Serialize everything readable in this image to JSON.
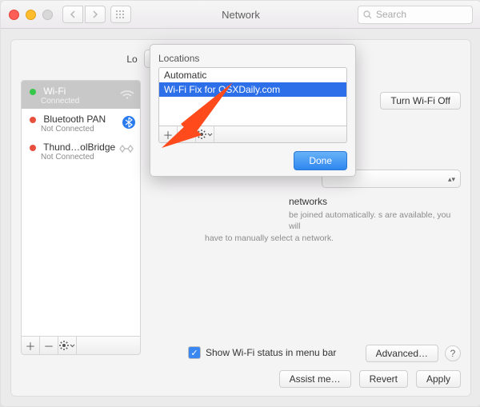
{
  "window": {
    "title": "Network"
  },
  "search": {
    "placeholder": "Search"
  },
  "location_label": "Lo",
  "services": [
    {
      "name": "Wi-Fi",
      "status": "Connected",
      "dot": "#37c84a",
      "selected": true,
      "icon": "wifi"
    },
    {
      "name": "Bluetooth PAN",
      "status": "Not Connected",
      "dot": "#e94f3d",
      "icon": "bluetooth"
    },
    {
      "name": "Thund…olBridge",
      "status": "Not Connected",
      "dot": "#e94f3d",
      "icon": "thunderbolt"
    }
  ],
  "right": {
    "turn_off": "Turn Wi-Fi Off",
    "networks_heading": "networks",
    "desc_line1": "be joined automatically.",
    "desc_line2": "s are available, you will",
    "desc_line3": "have to manually select a network.",
    "show_status": "Show Wi-Fi status in menu bar",
    "advanced": "Advanced…"
  },
  "footer": {
    "assist": "Assist me…",
    "revert": "Revert",
    "apply": "Apply"
  },
  "popover": {
    "header": "Locations",
    "items": [
      "Automatic",
      "Wi-Fi Fix for OSXDaily.com"
    ],
    "selected_index": 1,
    "done": "Done"
  },
  "colors": {
    "selection": "#2d6fe8",
    "accent_arrow": "#ff4a1c"
  }
}
